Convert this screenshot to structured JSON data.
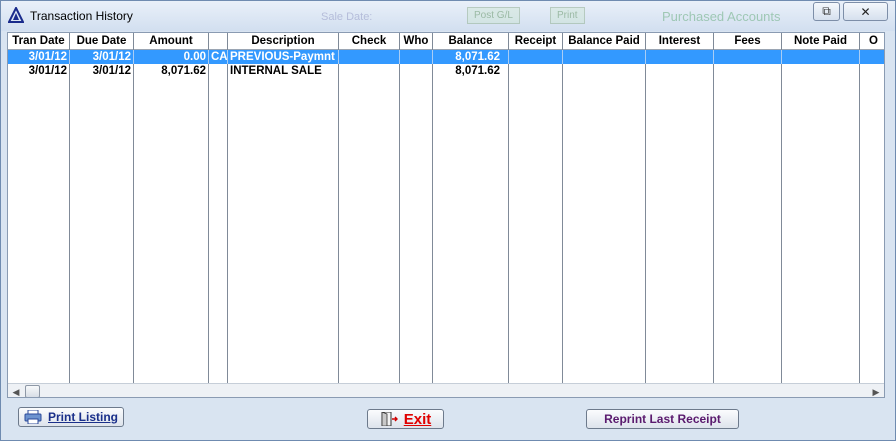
{
  "window": {
    "title": "Transaction History",
    "ghost_text": [
      "Sale Date:",
      "Post G/L",
      "Print",
      "Purchased Accounts"
    ],
    "controls": {
      "restore": "⧉",
      "close": "✕"
    }
  },
  "grid": {
    "columns": [
      "Tran Date",
      "Due Date",
      "Amount",
      "",
      "Description",
      "Check",
      "Who",
      "Balance",
      "Receipt",
      "Balance Paid",
      "Interest",
      "Fees",
      "Note Paid",
      "O"
    ],
    "rows": [
      {
        "tran_date": "3/01/12",
        "due_date": "3/01/12",
        "amount": "0.00",
        "type": "CA",
        "description": "PREVIOUS-Paymnt",
        "check": "",
        "who": "",
        "balance": "8,071.62",
        "receipt": "",
        "balance_paid": "",
        "interest": "",
        "fees": "",
        "note_paid": "",
        "selected": true
      },
      {
        "tran_date": "3/01/12",
        "due_date": "3/01/12",
        "amount": "8,071.62",
        "type": "",
        "description": "INTERNAL SALE",
        "check": "",
        "who": "",
        "balance": "8,071.62",
        "receipt": "",
        "balance_paid": "",
        "interest": "",
        "fees": "",
        "note_paid": "",
        "selected": false
      }
    ],
    "scroll_left_arrow": "◀",
    "scroll_right_arrow": "▶"
  },
  "buttons": {
    "print_listing": "Print Listing",
    "exit": "Exit",
    "reprint_last_receipt": "Reprint Last Receipt"
  },
  "colors": {
    "selection": "#3399ff",
    "exit_text": "#e00000",
    "title_bg": "#dbe6f3"
  }
}
